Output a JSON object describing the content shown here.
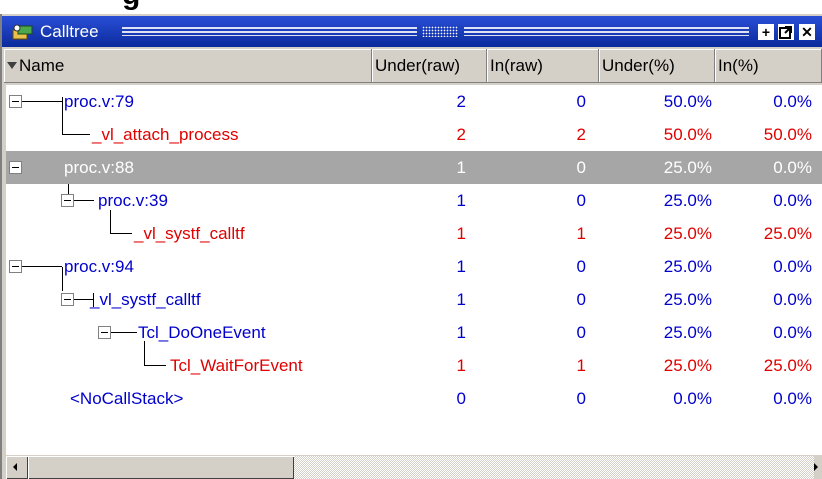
{
  "window": {
    "title": "Calltree",
    "partial_heading": "g"
  },
  "columns": [
    {
      "label": "Name"
    },
    {
      "label": "Under(raw)"
    },
    {
      "label": "In(raw)"
    },
    {
      "label": "Under(%)"
    },
    {
      "label": "In(%)"
    }
  ],
  "rows": [
    {
      "name": "proc.v:79",
      "under_raw": "2",
      "in_raw": "0",
      "under_pct": "50.0%",
      "in_pct": "0.0%",
      "color": "#0000cc",
      "selected": false
    },
    {
      "name": "_vl_attach_process",
      "under_raw": "2",
      "in_raw": "2",
      "under_pct": "50.0%",
      "in_pct": "50.0%",
      "color": "#e00000",
      "selected": false
    },
    {
      "name": "proc.v:88",
      "under_raw": "1",
      "in_raw": "0",
      "under_pct": "25.0%",
      "in_pct": "0.0%",
      "color": "#ffffff",
      "selected": true
    },
    {
      "name": "proc.v:39",
      "under_raw": "1",
      "in_raw": "0",
      "under_pct": "25.0%",
      "in_pct": "0.0%",
      "color": "#0000cc",
      "selected": false
    },
    {
      "name": "_vl_systf_calltf",
      "under_raw": "1",
      "in_raw": "1",
      "under_pct": "25.0%",
      "in_pct": "25.0%",
      "color": "#e00000",
      "selected": false
    },
    {
      "name": "proc.v:94",
      "under_raw": "1",
      "in_raw": "0",
      "under_pct": "25.0%",
      "in_pct": "0.0%",
      "color": "#0000cc",
      "selected": false
    },
    {
      "name": "_vl_systf_calltf",
      "under_raw": "1",
      "in_raw": "0",
      "under_pct": "25.0%",
      "in_pct": "0.0%",
      "color": "#0000cc",
      "selected": false
    },
    {
      "name": "Tcl_DoOneEvent",
      "under_raw": "1",
      "in_raw": "0",
      "under_pct": "25.0%",
      "in_pct": "0.0%",
      "color": "#0000cc",
      "selected": false
    },
    {
      "name": "Tcl_WaitForEvent",
      "under_raw": "1",
      "in_raw": "1",
      "under_pct": "25.0%",
      "in_pct": "25.0%",
      "color": "#e00000",
      "selected": false
    },
    {
      "name": "<NoCallStack>",
      "under_raw": "0",
      "in_raw": "0",
      "under_pct": "0.0%",
      "in_pct": "0.0%",
      "color": "#0000cc",
      "selected": false
    }
  ],
  "icons": {
    "titlebar": "calltree-icon",
    "buttons": [
      "maximize-icon",
      "float-icon",
      "close-icon"
    ],
    "expand": "collapse-icon"
  }
}
